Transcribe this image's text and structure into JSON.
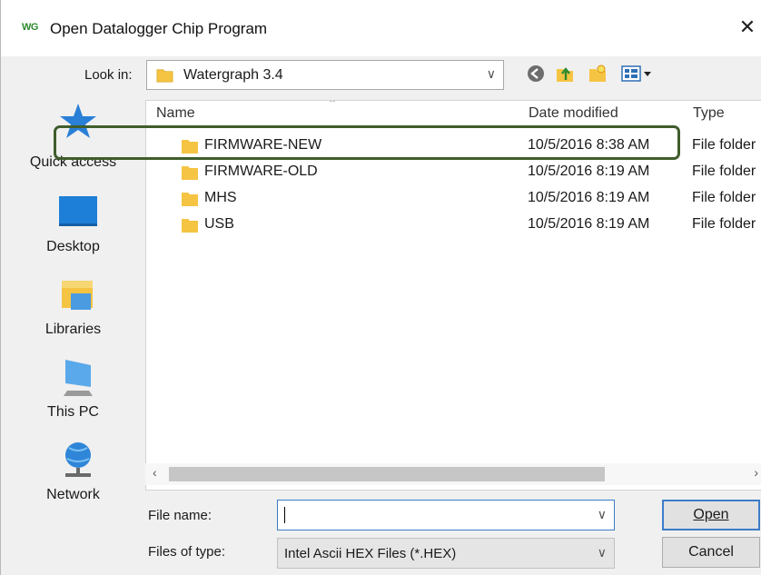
{
  "titlebar": {
    "logo_text": "WG",
    "title": "Open Datalogger Chip Program",
    "close_glyph": "✕"
  },
  "lookin": {
    "label": "Look in:",
    "value": "Watergraph 3.4",
    "icons": [
      "back-icon",
      "up-folder-icon",
      "new-folder-icon",
      "view-menu-icon"
    ]
  },
  "places": [
    {
      "label": "Quick access",
      "icon": "star-icon"
    },
    {
      "label": "Desktop",
      "icon": "desktop-icon"
    },
    {
      "label": "Libraries",
      "icon": "libraries-icon"
    },
    {
      "label": "This PC",
      "icon": "computer-icon"
    },
    {
      "label": "Network",
      "icon": "network-icon"
    }
  ],
  "columns": {
    "name": "Name",
    "date": "Date modified",
    "type": "Type"
  },
  "files": [
    {
      "name": "FIRMWARE-NEW",
      "date": "10/5/2016 8:38 AM",
      "type": "File folder"
    },
    {
      "name": "FIRMWARE-OLD",
      "date": "10/5/2016 8:19 AM",
      "type": "File folder"
    },
    {
      "name": "MHS",
      "date": "10/5/2016 8:19 AM",
      "type": "File folder"
    },
    {
      "name": "USB",
      "date": "10/5/2016 8:19 AM",
      "type": "File folder"
    }
  ],
  "form": {
    "filename_label": "File name:",
    "filename_value": "",
    "filetype_label": "Files of type:",
    "filetype_value": "Intel Ascii HEX Files (*.HEX)"
  },
  "buttons": {
    "open": "Open",
    "cancel": "Cancel"
  },
  "colors": {
    "highlight": "#3f5d2c",
    "focus": "#3d7cc9",
    "folder": "#f5c443"
  }
}
